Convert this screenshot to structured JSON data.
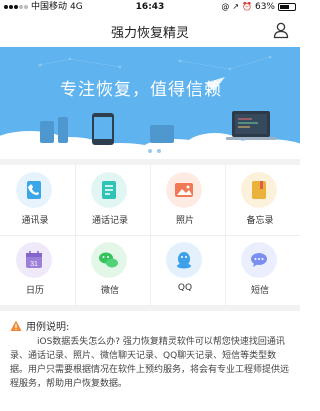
{
  "status_bar": {
    "carrier": "中国移动",
    "network": "4G",
    "time": "16:43",
    "battery": "63%"
  },
  "nav": {
    "title": "强力恢复精灵",
    "user_icon": "user-icon"
  },
  "banner": {
    "slogan": "专注恢复，值得信赖",
    "colors": {
      "sky": "#5fb3ee"
    }
  },
  "grid": {
    "items": [
      {
        "label": "通讯录",
        "icon": "contacts-icon",
        "color": "#3aa6e8"
      },
      {
        "label": "通话记录",
        "icon": "call-log-icon",
        "color": "#2fc4b6"
      },
      {
        "label": "照片",
        "icon": "photo-icon",
        "color": "#f07a55"
      },
      {
        "label": "备忘录",
        "icon": "memo-icon",
        "color": "#eab23b"
      },
      {
        "label": "日历",
        "icon": "calendar-icon",
        "color": "#9b7fd9"
      },
      {
        "label": "微信",
        "icon": "wechat-icon",
        "color": "#34c35c"
      },
      {
        "label": "QQ",
        "icon": "qq-icon",
        "color": "#3da0ea"
      },
      {
        "label": "短信",
        "icon": "sms-icon",
        "color": "#7b8ff0"
      }
    ]
  },
  "example": {
    "title": "用例说明:",
    "text": "iOS数据丢失怎么办? 强力恢复精灵软件可以帮您快速找回通讯录、通话记录、照片、微信聊天记录、QQ聊天记录、短信等类型数据。用户只需要根据情况在软件上预约服务，将会有专业工程师提供远程服务，帮助用户恢复数据。"
  }
}
